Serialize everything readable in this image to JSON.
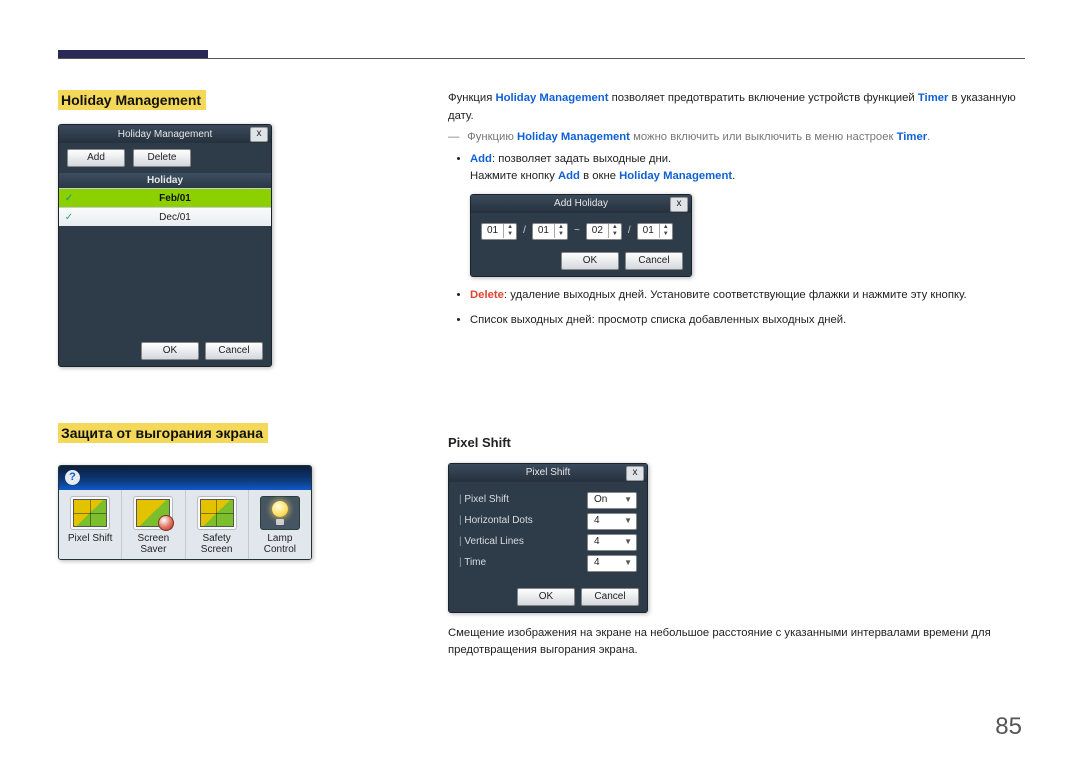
{
  "page_number": "85",
  "left": {
    "title_hm": "Holiday Management",
    "hm_win_title": "Holiday Management",
    "hm_add": "Add",
    "hm_delete": "Delete",
    "hm_col": "Holiday",
    "hm_rows": [
      "Feb/01",
      "Dec/01"
    ],
    "hm_ok": "OK",
    "hm_cancel": "Cancel",
    "title_burn": "Защита от выгорания экрана",
    "tiles": [
      "Pixel Shift",
      "Screen Saver",
      "Safety Screen",
      "Lamp Control"
    ]
  },
  "right": {
    "p1_a": "Функция ",
    "p1_b": "Holiday Management",
    "p1_c": " позволяет предотвратить включение устройств функцией ",
    "p1_d": "Timer",
    "p1_e": " в указанную дату.",
    "note_a": "Функцию ",
    "note_b": "Holiday Management",
    "note_c": " можно включить или выключить в меню настроек ",
    "note_d": "Timer",
    "note_e": ".",
    "bul_add_a": "Add",
    "bul_add_b": ": позволяет задать выходные дни.",
    "bul_add2_a": "Нажмите кнопку ",
    "bul_add2_b": "Add",
    "bul_add2_c": " в окне ",
    "bul_add2_d": "Holiday Management",
    "bul_add2_e": ".",
    "ah_title": "Add Holiday",
    "ah_vals": {
      "m1": "01",
      "d1": "01",
      "m2": "02",
      "d2": "01"
    },
    "ah_ok": "OK",
    "ah_cancel": "Cancel",
    "bul_del_a": "Delete",
    "bul_del_b": ": удаление выходных дней. Установите соответствующие флажки и нажмите эту кнопку.",
    "bul_list": "Список выходных дней: просмотр списка добавленных выходных дней.",
    "ps_heading": "Pixel Shift",
    "ps_title": "Pixel Shift",
    "ps_rows": {
      "pixel_shift": "Pixel Shift",
      "hdots": "Horizontal Dots",
      "vlines": "Vertical Lines",
      "time": "Time"
    },
    "ps_vals": {
      "on": "On",
      "h": "4",
      "v": "4",
      "t": "4"
    },
    "ps_ok": "OK",
    "ps_cancel": "Cancel",
    "ps_desc": "Смещение изображения на экране на небольшое расстояние с указанными интервалами времени для предотвращения выгорания экрана."
  }
}
